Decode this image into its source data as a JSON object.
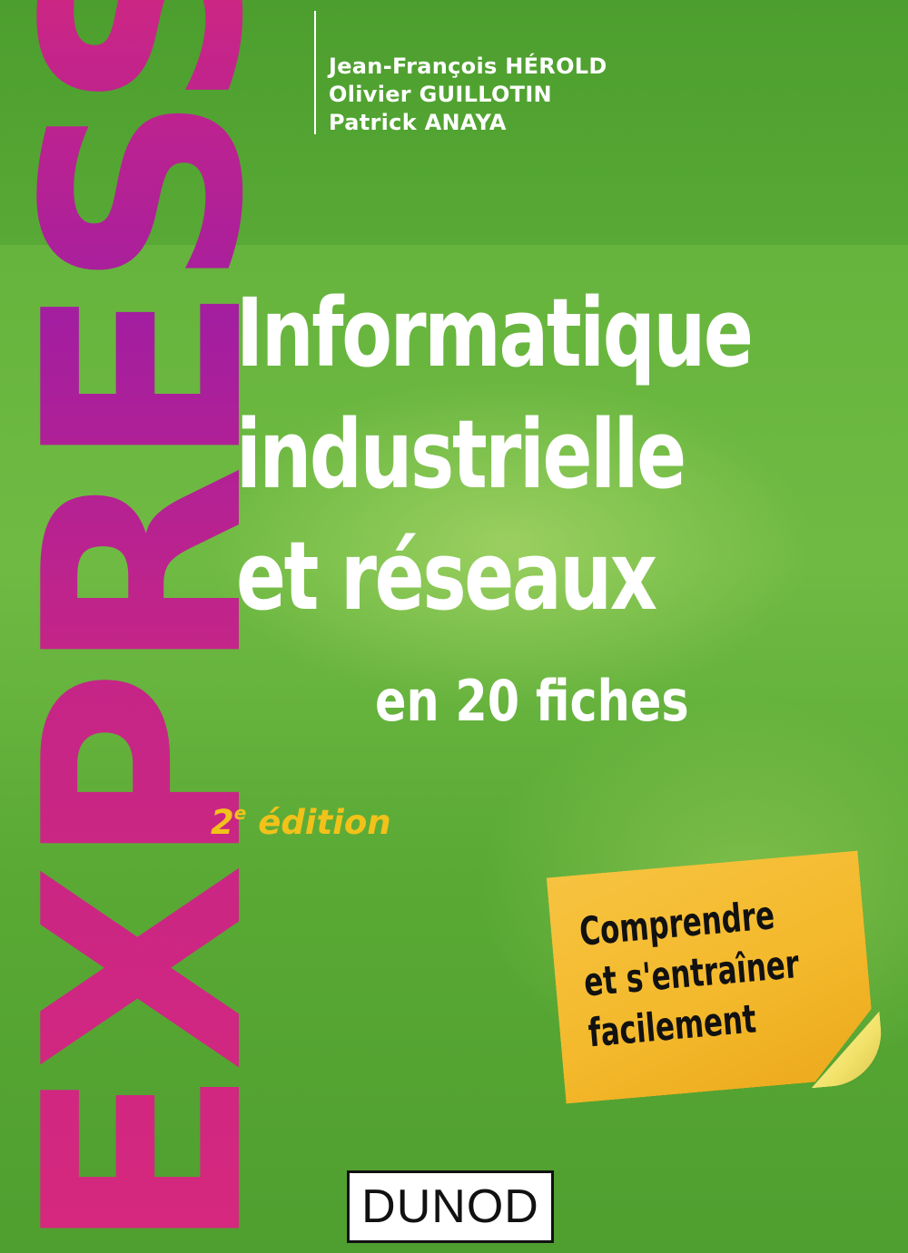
{
  "cover": {
    "series": "EXPRESS",
    "authors": [
      "Jean-François HÉROLD",
      "Olivier GUILLOTIN",
      "Patrick ANAYA"
    ],
    "title_lines": [
      "Informatique",
      "industrielle",
      "et réseaux"
    ],
    "subtitle": "en 20 fiches",
    "edition_number": "2",
    "edition_suffix": "e",
    "edition_word": "édition",
    "sticky_lines": [
      "Comprendre",
      "et s'entraîner",
      "facilement"
    ],
    "publisher": "DUNOD"
  },
  "colors": {
    "background_green": "#66b43d",
    "series_magenta": "#d6287e",
    "series_purple": "#a31ea0",
    "edition_yellow": "#f2c21a",
    "sticky_orange": "#f4b92c",
    "title_white": "#ffffff"
  }
}
